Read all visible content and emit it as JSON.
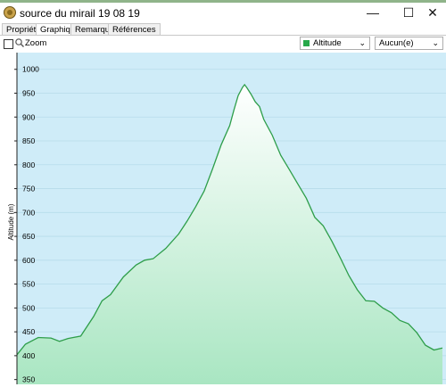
{
  "window": {
    "title": "source du mirail 19 08 19",
    "minimize_glyph": "—",
    "maximize_glyph": "☐",
    "close_glyph": "✕"
  },
  "tabs": [
    {
      "label": "Propriétés",
      "active": false
    },
    {
      "label": "Graphique",
      "active": true
    },
    {
      "label": "Remarques",
      "active": false
    },
    {
      "label": "Références",
      "active": false
    }
  ],
  "toolbar": {
    "zoom_label": "Zoom",
    "zoom_checked": false,
    "series_select": {
      "value": "Altitude",
      "swatch_color": "#27a84a"
    },
    "compare_select": {
      "value": "Aucun(e)"
    }
  },
  "chart_data": {
    "type": "area",
    "ylabel": "Altitude (m)",
    "xlabel": "",
    "yticks": [
      1000,
      950,
      900,
      850,
      800,
      750,
      700,
      650,
      600,
      550,
      500,
      450,
      400,
      350
    ],
    "ylim": [
      340,
      1035
    ],
    "grid": true,
    "line_color": "#2e9e4a",
    "fill_top_color": "#ffffff",
    "fill_bottom_color": "#a9e6c2",
    "background_color": "#cfecf8",
    "x": [
      0,
      2,
      5,
      8,
      10,
      12,
      15,
      18,
      20,
      22,
      25,
      28,
      30,
      32,
      35,
      38,
      40,
      42,
      44,
      46,
      48,
      50,
      51,
      52,
      53,
      53.5,
      54,
      55,
      56,
      57,
      58,
      60,
      62,
      64,
      66,
      68,
      70,
      72,
      74,
      76,
      78,
      80,
      82,
      84,
      86,
      88,
      90,
      92,
      94,
      96,
      98,
      100
    ],
    "values": [
      402,
      424,
      438,
      437,
      430,
      436,
      441,
      482,
      515,
      528,
      565,
      590,
      600,
      603,
      625,
      655,
      682,
      712,
      745,
      792,
      842,
      882,
      915,
      945,
      962,
      968,
      962,
      948,
      932,
      922,
      895,
      862,
      820,
      790,
      760,
      730,
      690,
      672,
      640,
      605,
      568,
      538,
      515,
      514,
      500,
      490,
      474,
      467,
      448,
      422,
      412,
      416
    ]
  }
}
